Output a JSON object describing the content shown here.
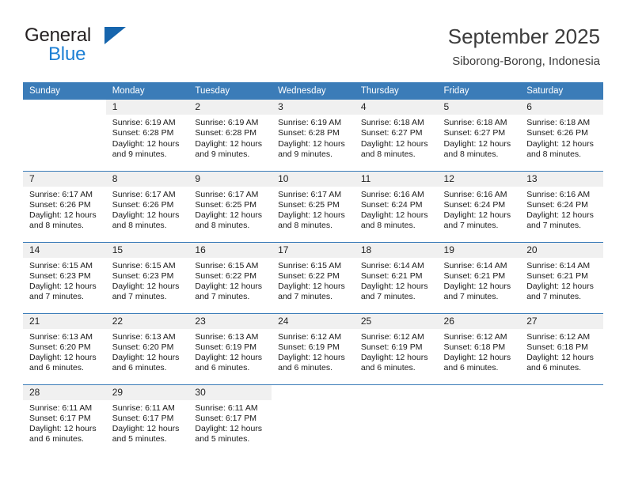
{
  "brand": {
    "word1": "General",
    "word2": "Blue",
    "flag_color": "#1665ad",
    "blue_text_color": "#1c7fd4"
  },
  "header": {
    "title": "September 2025",
    "subtitle": "Siborong-Borong, Indonesia"
  },
  "theme": {
    "header_row_bg": "#3b7cb8",
    "daynum_bg": "#f0f0f0",
    "grid_line": "#3b7cb8"
  },
  "weekday_headers": [
    "Sunday",
    "Monday",
    "Tuesday",
    "Wednesday",
    "Thursday",
    "Friday",
    "Saturday"
  ],
  "weeks": [
    [
      {
        "day": "",
        "sunrise": "",
        "sunset": "",
        "daylight_l1": "",
        "daylight_l2": "",
        "blank": true
      },
      {
        "day": "1",
        "sunrise": "Sunrise: 6:19 AM",
        "sunset": "Sunset: 6:28 PM",
        "daylight_l1": "Daylight: 12 hours",
        "daylight_l2": "and 9 minutes."
      },
      {
        "day": "2",
        "sunrise": "Sunrise: 6:19 AM",
        "sunset": "Sunset: 6:28 PM",
        "daylight_l1": "Daylight: 12 hours",
        "daylight_l2": "and 9 minutes."
      },
      {
        "day": "3",
        "sunrise": "Sunrise: 6:19 AM",
        "sunset": "Sunset: 6:28 PM",
        "daylight_l1": "Daylight: 12 hours",
        "daylight_l2": "and 9 minutes."
      },
      {
        "day": "4",
        "sunrise": "Sunrise: 6:18 AM",
        "sunset": "Sunset: 6:27 PM",
        "daylight_l1": "Daylight: 12 hours",
        "daylight_l2": "and 8 minutes."
      },
      {
        "day": "5",
        "sunrise": "Sunrise: 6:18 AM",
        "sunset": "Sunset: 6:27 PM",
        "daylight_l1": "Daylight: 12 hours",
        "daylight_l2": "and 8 minutes."
      },
      {
        "day": "6",
        "sunrise": "Sunrise: 6:18 AM",
        "sunset": "Sunset: 6:26 PM",
        "daylight_l1": "Daylight: 12 hours",
        "daylight_l2": "and 8 minutes."
      }
    ],
    [
      {
        "day": "7",
        "sunrise": "Sunrise: 6:17 AM",
        "sunset": "Sunset: 6:26 PM",
        "daylight_l1": "Daylight: 12 hours",
        "daylight_l2": "and 8 minutes."
      },
      {
        "day": "8",
        "sunrise": "Sunrise: 6:17 AM",
        "sunset": "Sunset: 6:26 PM",
        "daylight_l1": "Daylight: 12 hours",
        "daylight_l2": "and 8 minutes."
      },
      {
        "day": "9",
        "sunrise": "Sunrise: 6:17 AM",
        "sunset": "Sunset: 6:25 PM",
        "daylight_l1": "Daylight: 12 hours",
        "daylight_l2": "and 8 minutes."
      },
      {
        "day": "10",
        "sunrise": "Sunrise: 6:17 AM",
        "sunset": "Sunset: 6:25 PM",
        "daylight_l1": "Daylight: 12 hours",
        "daylight_l2": "and 8 minutes."
      },
      {
        "day": "11",
        "sunrise": "Sunrise: 6:16 AM",
        "sunset": "Sunset: 6:24 PM",
        "daylight_l1": "Daylight: 12 hours",
        "daylight_l2": "and 8 minutes."
      },
      {
        "day": "12",
        "sunrise": "Sunrise: 6:16 AM",
        "sunset": "Sunset: 6:24 PM",
        "daylight_l1": "Daylight: 12 hours",
        "daylight_l2": "and 7 minutes."
      },
      {
        "day": "13",
        "sunrise": "Sunrise: 6:16 AM",
        "sunset": "Sunset: 6:24 PM",
        "daylight_l1": "Daylight: 12 hours",
        "daylight_l2": "and 7 minutes."
      }
    ],
    [
      {
        "day": "14",
        "sunrise": "Sunrise: 6:15 AM",
        "sunset": "Sunset: 6:23 PM",
        "daylight_l1": "Daylight: 12 hours",
        "daylight_l2": "and 7 minutes."
      },
      {
        "day": "15",
        "sunrise": "Sunrise: 6:15 AM",
        "sunset": "Sunset: 6:23 PM",
        "daylight_l1": "Daylight: 12 hours",
        "daylight_l2": "and 7 minutes."
      },
      {
        "day": "16",
        "sunrise": "Sunrise: 6:15 AM",
        "sunset": "Sunset: 6:22 PM",
        "daylight_l1": "Daylight: 12 hours",
        "daylight_l2": "and 7 minutes."
      },
      {
        "day": "17",
        "sunrise": "Sunrise: 6:15 AM",
        "sunset": "Sunset: 6:22 PM",
        "daylight_l1": "Daylight: 12 hours",
        "daylight_l2": "and 7 minutes."
      },
      {
        "day": "18",
        "sunrise": "Sunrise: 6:14 AM",
        "sunset": "Sunset: 6:21 PM",
        "daylight_l1": "Daylight: 12 hours",
        "daylight_l2": "and 7 minutes."
      },
      {
        "day": "19",
        "sunrise": "Sunrise: 6:14 AM",
        "sunset": "Sunset: 6:21 PM",
        "daylight_l1": "Daylight: 12 hours",
        "daylight_l2": "and 7 minutes."
      },
      {
        "day": "20",
        "sunrise": "Sunrise: 6:14 AM",
        "sunset": "Sunset: 6:21 PM",
        "daylight_l1": "Daylight: 12 hours",
        "daylight_l2": "and 7 minutes."
      }
    ],
    [
      {
        "day": "21",
        "sunrise": "Sunrise: 6:13 AM",
        "sunset": "Sunset: 6:20 PM",
        "daylight_l1": "Daylight: 12 hours",
        "daylight_l2": "and 6 minutes."
      },
      {
        "day": "22",
        "sunrise": "Sunrise: 6:13 AM",
        "sunset": "Sunset: 6:20 PM",
        "daylight_l1": "Daylight: 12 hours",
        "daylight_l2": "and 6 minutes."
      },
      {
        "day": "23",
        "sunrise": "Sunrise: 6:13 AM",
        "sunset": "Sunset: 6:19 PM",
        "daylight_l1": "Daylight: 12 hours",
        "daylight_l2": "and 6 minutes."
      },
      {
        "day": "24",
        "sunrise": "Sunrise: 6:12 AM",
        "sunset": "Sunset: 6:19 PM",
        "daylight_l1": "Daylight: 12 hours",
        "daylight_l2": "and 6 minutes."
      },
      {
        "day": "25",
        "sunrise": "Sunrise: 6:12 AM",
        "sunset": "Sunset: 6:19 PM",
        "daylight_l1": "Daylight: 12 hours",
        "daylight_l2": "and 6 minutes."
      },
      {
        "day": "26",
        "sunrise": "Sunrise: 6:12 AM",
        "sunset": "Sunset: 6:18 PM",
        "daylight_l1": "Daylight: 12 hours",
        "daylight_l2": "and 6 minutes."
      },
      {
        "day": "27",
        "sunrise": "Sunrise: 6:12 AM",
        "sunset": "Sunset: 6:18 PM",
        "daylight_l1": "Daylight: 12 hours",
        "daylight_l2": "and 6 minutes."
      }
    ],
    [
      {
        "day": "28",
        "sunrise": "Sunrise: 6:11 AM",
        "sunset": "Sunset: 6:17 PM",
        "daylight_l1": "Daylight: 12 hours",
        "daylight_l2": "and 6 minutes."
      },
      {
        "day": "29",
        "sunrise": "Sunrise: 6:11 AM",
        "sunset": "Sunset: 6:17 PM",
        "daylight_l1": "Daylight: 12 hours",
        "daylight_l2": "and 5 minutes."
      },
      {
        "day": "30",
        "sunrise": "Sunrise: 6:11 AM",
        "sunset": "Sunset: 6:17 PM",
        "daylight_l1": "Daylight: 12 hours",
        "daylight_l2": "and 5 minutes."
      },
      {
        "day": "",
        "sunrise": "",
        "sunset": "",
        "daylight_l1": "",
        "daylight_l2": "",
        "blank": true
      },
      {
        "day": "",
        "sunrise": "",
        "sunset": "",
        "daylight_l1": "",
        "daylight_l2": "",
        "blank": true
      },
      {
        "day": "",
        "sunrise": "",
        "sunset": "",
        "daylight_l1": "",
        "daylight_l2": "",
        "blank": true
      },
      {
        "day": "",
        "sunrise": "",
        "sunset": "",
        "daylight_l1": "",
        "daylight_l2": "",
        "blank": true
      }
    ]
  ]
}
